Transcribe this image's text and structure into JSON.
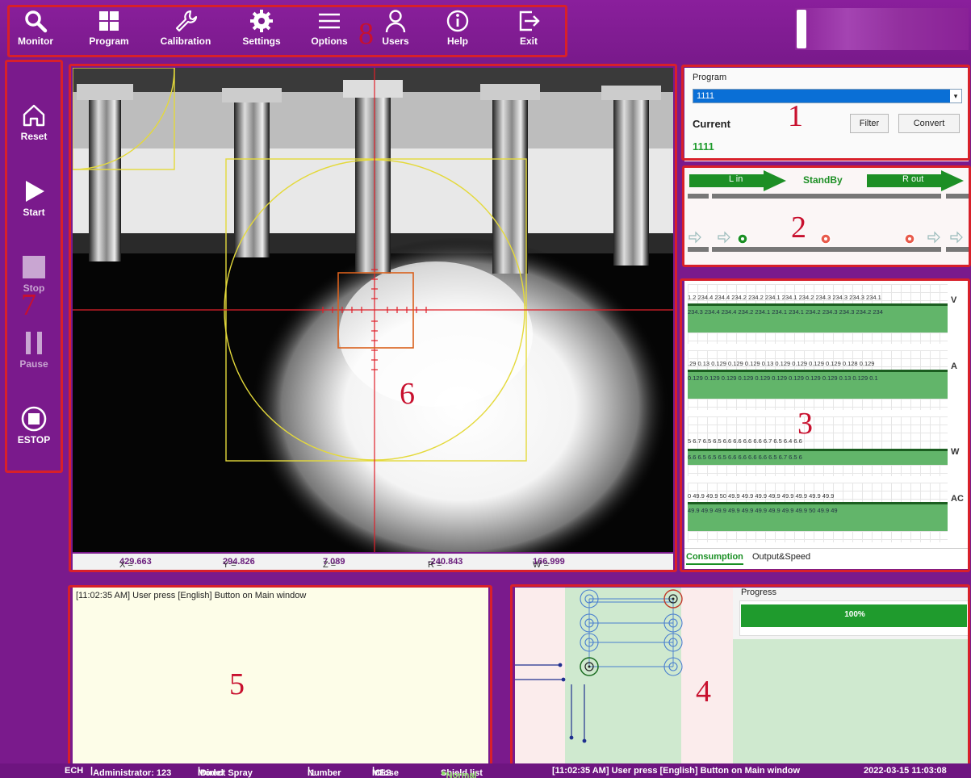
{
  "toolbar": {
    "items": [
      {
        "label": "Monitor",
        "icon": "search-icon"
      },
      {
        "label": "Program",
        "icon": "grid-icon"
      },
      {
        "label": "Calibration",
        "icon": "wrench-icon"
      },
      {
        "label": "Settings",
        "icon": "gear-icon"
      },
      {
        "label": "Options",
        "icon": "menu-icon"
      },
      {
        "label": "Users",
        "icon": "user-icon"
      },
      {
        "label": "Help",
        "icon": "info-icon"
      },
      {
        "label": "Exit",
        "icon": "exit-icon"
      }
    ]
  },
  "sidebar": {
    "items": [
      {
        "label": "Reset",
        "icon": "home-icon",
        "enabled": true
      },
      {
        "label": "Start",
        "icon": "play-icon",
        "enabled": true
      },
      {
        "label": "Stop",
        "icon": "stop-icon",
        "enabled": false
      },
      {
        "label": "Pause",
        "icon": "pause-icon",
        "enabled": false
      },
      {
        "label": "ESTOP",
        "icon": "estop-icon",
        "enabled": true
      }
    ]
  },
  "annotations": [
    "1",
    "2",
    "3",
    "4",
    "5",
    "6",
    "7",
    "8"
  ],
  "camera": {
    "coords": {
      "x": "X = ",
      "x_val": "429.663",
      "y": "Y = ",
      "y_val": "294.826",
      "z": "Z = ",
      "z_val": "7.089",
      "r": "R = ",
      "r_val": "-240.843",
      "w": "W = ",
      "w_val": "166.999"
    }
  },
  "program": {
    "group_label": "Program",
    "selected": "1111",
    "current_label": "Current",
    "current_value": "1111",
    "filter_label": "Filter",
    "convert_label": "Convert"
  },
  "line": {
    "left_label": "L in",
    "state": "StandBy",
    "right_label": "R out"
  },
  "charts": {
    "rows": [
      {
        "unit": "V",
        "top": "1.2 234.4 234.4 234.2 234.2 234.1 234.1 234.2 234.3 234.3 234.3 234.1",
        "bottom": "234.3 234.4 234.4 234.2 234.1 234.1 234.1 234.2 234.3 234.3 234.2 234"
      },
      {
        "unit": "A",
        "top": ".29 0.13 0.129 0.129 0.129 0.13 0.129 0.129 0.129 0.129 0.128 0.129",
        "bottom": "0.129 0.129 0.129 0.129 0.129 0.129 0.129 0.129 0.129 0.13 0.129 0.1"
      },
      {
        "unit": "W",
        "top": "5 6.7 6.5 6.5 6.6 6.6 6.6 6.6 6.7 6.5 6.4 6.6",
        "bottom": "6.6 6.5 6.5 6.5 6.6 6.6 6.6 6.6 6.5 6.7 6.5 6"
      },
      {
        "unit": "AC",
        "top": "0 49.9 49.9 50 49.9 49.9 49.9 49.9 49.9 49.9 49.9 49.9",
        "bottom": "49.9 49.9 49.9 49.9 49.9 49.9 49.9 49.9 49.9 50 49.9 49"
      }
    ],
    "tabs": [
      "Consumption",
      "Output&Speed"
    ]
  },
  "log": {
    "lines": [
      "[11:02:35 AM] User press [English] Button on  Main window"
    ]
  },
  "progress": {
    "label": "Progress",
    "value_text": "100%",
    "fraction": 1.0
  },
  "statusbar": {
    "company": "ECH",
    "user": "Administrator: 123",
    "model_label": "Model",
    "model_value": "Direct Spray",
    "number_label": "Number",
    "number_value": "1",
    "mes_label": "MES",
    "mes_value": "Close",
    "shield_label": "Shield list",
    "shield_value": "Normal",
    "message": "[11:02:35 AM] User press [English] Button on  Main window",
    "datetime": "2022-03-15  11:03:08"
  },
  "colors": {
    "accent": "#7a1a8c",
    "annotation": "#d8202a",
    "ok_green": "#1f9b2d",
    "selection_blue": "#0a6fd6"
  }
}
